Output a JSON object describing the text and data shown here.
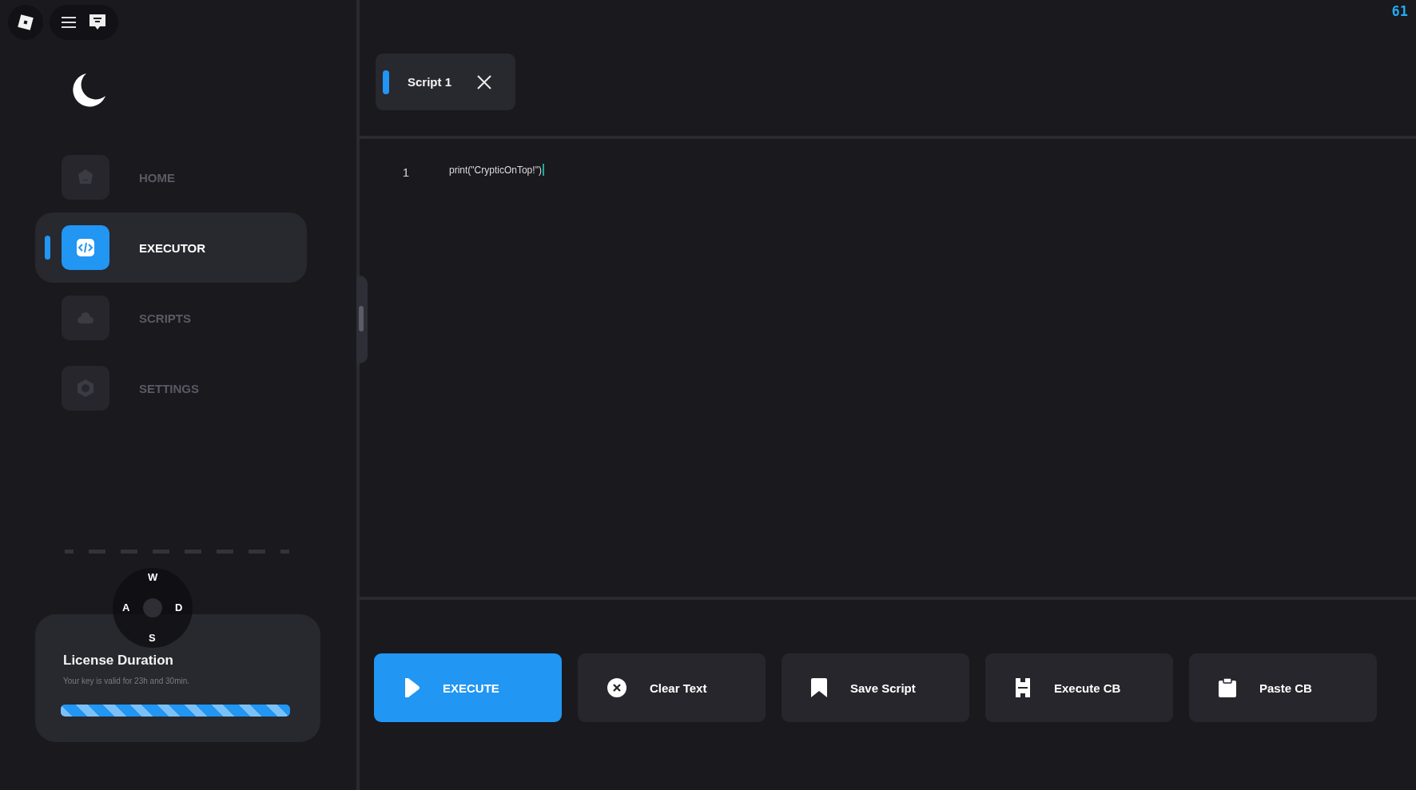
{
  "fps": "61",
  "nav": [
    {
      "label": "HOME",
      "kind": "home",
      "selected": false
    },
    {
      "label": "EXECUTOR",
      "kind": "code",
      "selected": true
    },
    {
      "label": "SCRIPTS",
      "kind": "cloud",
      "selected": false
    },
    {
      "label": "SETTINGS",
      "kind": "gear",
      "selected": false
    }
  ],
  "license": {
    "title": "License Duration",
    "text": "Your key is valid for 23h and 30min.",
    "level": 1
  },
  "joystick": {
    "up": "W",
    "left": "A",
    "right": "D",
    "down": "S"
  },
  "tabs": [
    {
      "label": "Script 1",
      "selected": true
    }
  ],
  "editor": {
    "lines": [
      {
        "number": "1",
        "code": "print(\"CrypticOnTop!\")"
      }
    ]
  },
  "actions": [
    {
      "label": "EXECUTE",
      "kind": "play",
      "primary": true
    },
    {
      "label": "Clear Text",
      "kind": "clear",
      "primary": false
    },
    {
      "label": "Save Script",
      "kind": "bookmark",
      "primary": false
    },
    {
      "label": "Execute CB",
      "kind": "cb",
      "primary": false
    },
    {
      "label": "Paste CB",
      "kind": "clipboard",
      "primary": false
    }
  ]
}
